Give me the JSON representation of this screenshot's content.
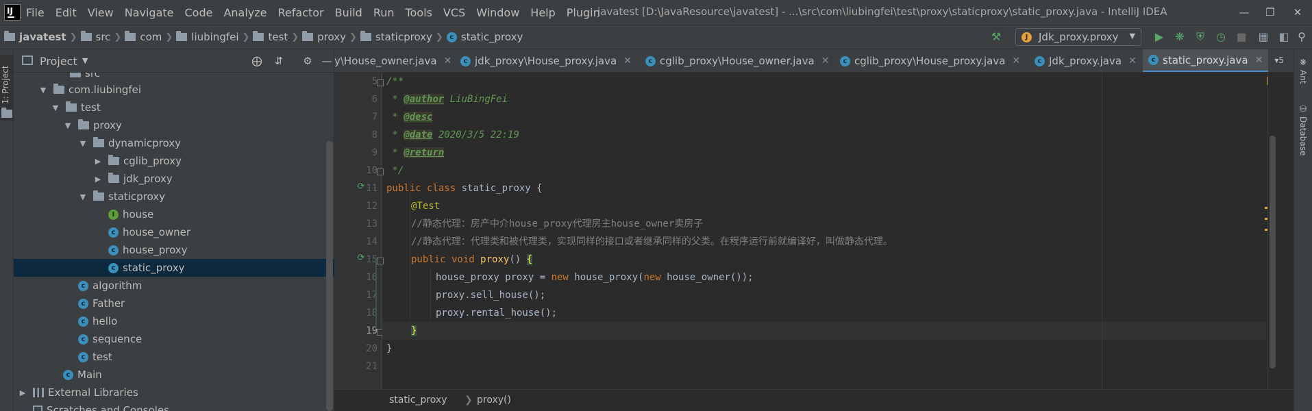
{
  "menu": [
    "File",
    "Edit",
    "View",
    "Navigate",
    "Code",
    "Analyze",
    "Refactor",
    "Build",
    "Run",
    "Tools",
    "VCS",
    "Window",
    "Help",
    "Plugin"
  ],
  "window_title": "javatest [D:\\JavaResource\\javatest] - ...\\src\\com\\liubingfei\\test\\proxy\\staticproxy\\static_proxy.java - IntelliJ IDEA",
  "app_logo_text": "IJ",
  "breadcrumb": [
    "javatest",
    "src",
    "com",
    "liubingfei",
    "test",
    "proxy",
    "staticproxy",
    "static_proxy"
  ],
  "run_config": "Jdk_proxy.proxy",
  "project_panel": {
    "title": "Project",
    "side_tab": "1: Project",
    "tree": [
      {
        "label": "src",
        "arrow": "",
        "icon": "folder"
      },
      {
        "label": "com.liubingfei",
        "arrow": "down",
        "icon": "folder"
      },
      {
        "label": "test",
        "arrow": "down",
        "icon": "folder"
      },
      {
        "label": "proxy",
        "arrow": "down",
        "icon": "folder"
      },
      {
        "label": "dynamicproxy",
        "arrow": "down",
        "icon": "folder"
      },
      {
        "label": "cglib_proxy",
        "arrow": "right",
        "icon": "folder"
      },
      {
        "label": "jdk_proxy",
        "arrow": "right",
        "icon": "folder"
      },
      {
        "label": "staticproxy",
        "arrow": "down",
        "icon": "folder"
      },
      {
        "label": "house",
        "arrow": "",
        "icon": "interface"
      },
      {
        "label": "house_owner",
        "arrow": "",
        "icon": "class"
      },
      {
        "label": "house_proxy",
        "arrow": "",
        "icon": "class"
      },
      {
        "label": "static_proxy",
        "arrow": "",
        "icon": "class-test",
        "selected": true
      },
      {
        "label": "algorithm",
        "arrow": "",
        "icon": "class"
      },
      {
        "label": "Father",
        "arrow": "",
        "icon": "class"
      },
      {
        "label": "hello",
        "arrow": "",
        "icon": "class"
      },
      {
        "label": "sequence",
        "arrow": "",
        "icon": "class"
      },
      {
        "label": "test",
        "arrow": "",
        "icon": "class"
      },
      {
        "label": "Main",
        "arrow": "",
        "icon": "class"
      },
      {
        "label": "External Libraries",
        "arrow": "right",
        "icon": "library"
      },
      {
        "label": "Scratches and Consoles",
        "arrow": "",
        "icon": "scratch"
      }
    ]
  },
  "tabs": [
    {
      "label": "y\\House_owner.java",
      "active": false
    },
    {
      "label": "jdk_proxy\\House_proxy.java",
      "active": false
    },
    {
      "label": "cglib_proxy\\House_owner.java",
      "active": false
    },
    {
      "label": "cglib_proxy\\House_proxy.java",
      "active": false
    },
    {
      "label": "Jdk_proxy.java",
      "active": false
    },
    {
      "label": "static_proxy.java",
      "active": true
    }
  ],
  "tab_overflow": "5",
  "editor": {
    "line_numbers": [
      "5",
      "6",
      "7",
      "8",
      "9",
      "10",
      "11",
      "12",
      "13",
      "14",
      "15",
      "16",
      "17",
      "18",
      "19",
      "20",
      "21"
    ],
    "code": {
      "l5": "/**",
      "l6_star": " * ",
      "l6_tag": "@author",
      "l6_text": " LiuBingFei",
      "l7_star": " * ",
      "l7_tag": "@desc",
      "l8_star": " * ",
      "l8_tag": "@date",
      "l8_text": " 2020/3/5 22:19",
      "l9_star": " * ",
      "l9_tag": "@return",
      "l10": " */",
      "l11_kw": "public class",
      "l11_text": " static_proxy {",
      "l12_ann": "@Test",
      "l13": "//静态代理：房产中介house_proxy代理房主house_owner卖房子",
      "l14": "//静态代理：代理类和被代理类，实现同样的接口或者继承同样的父类。在程序运行前就编译好，叫做静态代理。",
      "l15_kw": "public void",
      "l15_fn": "proxy",
      "l15_rest": "() ",
      "l15_brace": "{",
      "l16_a": "house_proxy proxy = ",
      "l16_new1": "new",
      "l16_b": " house_proxy(",
      "l16_new2": "new",
      "l16_c": " house_owner());",
      "l17": "proxy.sell_house();",
      "l18": "proxy.rental_house();",
      "l19_brace": "}",
      "l20": "}"
    }
  },
  "editor_breadcrumb": [
    "static_proxy",
    "proxy()"
  ],
  "right_strip": {
    "ant": "Ant",
    "database": "Database"
  },
  "colors": {
    "accent": "#4a88c7",
    "keyword": "#cc7832",
    "doc_comment": "#629755",
    "annotation": "#bbb529",
    "method": "#ffc66d",
    "warning": "#d9a343"
  }
}
